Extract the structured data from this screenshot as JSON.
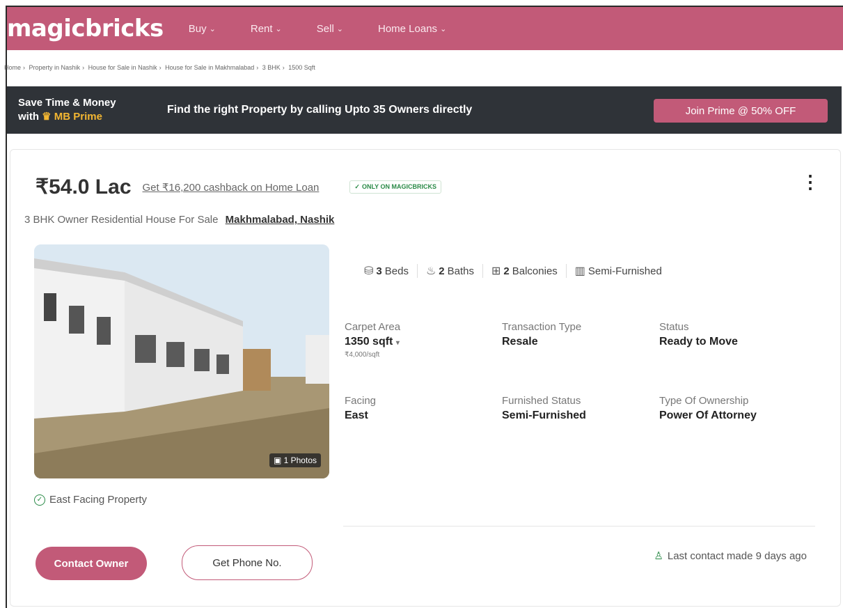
{
  "nav": {
    "logo": "magicbricks",
    "items": [
      {
        "label": "Buy"
      },
      {
        "label": "Rent"
      },
      {
        "label": "Sell"
      },
      {
        "label": "Home Loans"
      }
    ]
  },
  "breadcrumb": [
    "Home",
    "Property in Nashik",
    "House for Sale in Nashik",
    "House for Sale in Makhmalabad",
    "3 BHK",
    "1500 Sqft"
  ],
  "prime": {
    "line1": "Save Time & Money",
    "line2_prefix": "with",
    "line2_brand": "MB Prime",
    "message": "Find the right Property by calling Upto 35 Owners directly",
    "cta": "Join Prime @ 50% OFF"
  },
  "listing": {
    "price": "₹54.0 Lac",
    "cashback": "Get ₹16,200 cashback on Home Loan",
    "badge": "ONLY ON MAGICBRICKS",
    "subtitle": "3 BHK Owner Residential House For Sale",
    "location": "Makhmalabad, Nashik",
    "photos": "1 Photos",
    "amenities": {
      "beds_num": "3",
      "beds": "Beds",
      "baths_num": "2",
      "baths": "Baths",
      "balconies_num": "2",
      "balconies": "Balconies",
      "furnished": "Semi-Furnished"
    },
    "details": {
      "carpet_label": "Carpet Area",
      "carpet_value": "1350 sqft",
      "carpet_rate": "₹4,000/sqft",
      "txn_label": "Transaction Type",
      "txn_value": "Resale",
      "status_label": "Status",
      "status_value": "Ready to Move",
      "facing_label": "Facing",
      "facing_value": "East",
      "furnished_label": "Furnished Status",
      "furnished_value": "Semi-Furnished",
      "ownership_label": "Type Of Ownership",
      "ownership_value": "Power Of Attorney"
    },
    "highlight": "East Facing Property",
    "contact_button": "Contact Owner",
    "phone_button": "Get Phone No.",
    "last_contact": "Last contact made 9 days ago"
  },
  "colors": {
    "brand": "#c25a78",
    "banner_bg": "#2f3338",
    "gold": "#f2b632",
    "green": "#2a8a47"
  }
}
